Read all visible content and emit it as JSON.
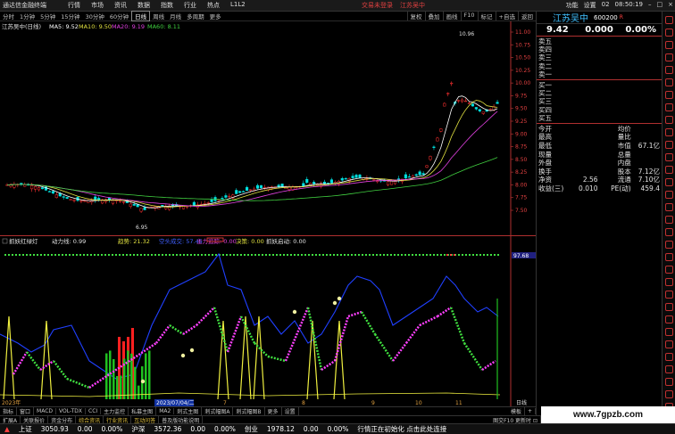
{
  "app": {
    "logo": "通达信金融终端",
    "menu": [
      "行情",
      "市场",
      "资讯",
      "数据",
      "指数",
      "行业",
      "热点",
      "L1L2"
    ],
    "alert": "交易未登录",
    "alert2": "江苏吴中",
    "right": [
      "功能",
      "设置",
      "02",
      "08:50:19"
    ]
  },
  "toolbar": {
    "periods": [
      "分时",
      "1分钟",
      "5分钟",
      "15分钟",
      "30分钟",
      "60分钟",
      "日线",
      "周线",
      "月线",
      "多周期",
      "更多"
    ],
    "active": "日线",
    "right_btns": [
      "复权",
      "叠加",
      "画线",
      "F10",
      "标记",
      "+自选",
      "返回"
    ]
  },
  "main_chart": {
    "title": "江苏吴中(日线)",
    "ma5": "MA5: 9.52",
    "ma10": "MA10: 9.50",
    "ma20": "MA20: 9.19",
    "ma60": "MA60: 8.11",
    "high_label": "10.96",
    "low_label": "6.95",
    "y_labels": [
      "11.00",
      "10.75",
      "10.50",
      "10.25",
      "10.00",
      "9.75",
      "9.50",
      "9.25",
      "9.00",
      "8.75",
      "8.50",
      "8.25",
      "8.00",
      "7.75",
      "7.50"
    ]
  },
  "ind_chart": {
    "name": "抓妖红绿灯",
    "v1": "动力线: 0.99",
    "v2": "趋势: 21.32",
    "v3": "空头成交: 57.45",
    "v4": "主力追踪: 0.00",
    "v5": "决策: 0.00",
    "v6": "抓妖启动: 0.00",
    "y_top": "97.68",
    "date_left": "2023年",
    "date_mid": "2023/07/04/二",
    "x_marks": [
      "7",
      "8",
      "9",
      "10",
      "11"
    ],
    "x_right": "日线"
  },
  "rpanel": {
    "name": "江苏吴中",
    "code": "600200",
    "badge": "R",
    "price": "9.42",
    "change": "0.000",
    "pct": "0.00%",
    "orderbook": [
      "卖五",
      "卖四",
      "卖三",
      "卖二",
      "卖一",
      "买一",
      "买二",
      "买三",
      "买四",
      "买五"
    ],
    "stats": [
      {
        "a": "今开",
        "b": "",
        "c": "均价",
        "d": ""
      },
      {
        "a": "最高",
        "b": "",
        "c": "量比",
        "d": ""
      },
      {
        "a": "最低",
        "b": "",
        "c": "市值",
        "d": "67.1亿"
      },
      {
        "a": "现量",
        "b": "",
        "c": "总量",
        "d": ""
      },
      {
        "a": "外盘",
        "b": "",
        "c": "内盘",
        "d": ""
      },
      {
        "a": "换手",
        "b": "",
        "c": "股本",
        "d": "7.12亿"
      },
      {
        "a": "净资",
        "b": "2.56",
        "c": "流通",
        "d": "7.10亿"
      },
      {
        "a": "收益(三)",
        "b": "0.010",
        "c": "PE(动)",
        "d": "459.4"
      }
    ]
  },
  "tabs1": [
    "指标",
    "窗口",
    "MACD",
    "VOL-TDX",
    "CCI",
    "主力监控",
    "私募主图",
    "MA2",
    "刺式主图",
    "刺式幅图A",
    "刺式幅图B",
    "更多",
    "设置",
    "",
    "模板",
    "+"
  ],
  "tabs2": [
    "扩展A",
    "关联报价",
    "资金分布",
    "综合资讯",
    "行业资讯",
    "互动问答",
    "普及版功能说明"
  ],
  "tabs2_right": "图交F10 更新时 ⊡",
  "status": {
    "sh_name": "上证",
    "sh_val": "3050.93",
    "sh_chg": "0.00",
    "sh_pct": "0.00%",
    "sz_name": "沪深",
    "sz_val": "3572.36",
    "sz_chg": "0.00",
    "sz_pct": "0.00%",
    "cy_name": "创业",
    "cy_val": "1978.12",
    "cy_chg": "0.00",
    "cy_pct": "0.00%",
    "msg": "行情正在初始化 点击此处连接"
  },
  "watermark": "www.7gpzb.com",
  "colors": {
    "up": "#ff3030",
    "down": "#00e0e0",
    "ma5": "#ffffff",
    "ma10": "#e0e040",
    "ma20": "#e040e0",
    "ma60": "#40d040"
  }
}
